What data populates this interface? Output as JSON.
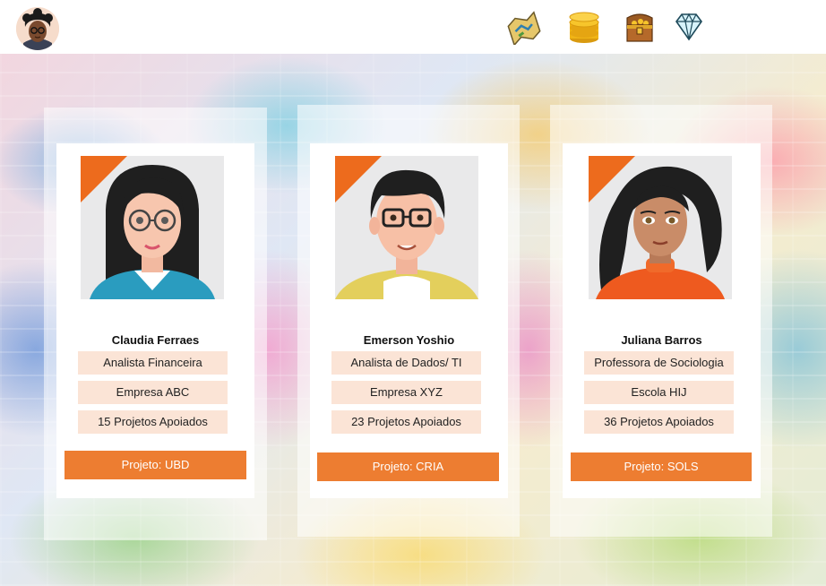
{
  "header": {
    "icons": [
      "map-icon",
      "coins-icon",
      "treasure-chest-icon",
      "diamond-icon"
    ]
  },
  "colors": {
    "accent": "#ed7d31",
    "info_box": "#fbe4d6"
  },
  "cards": [
    {
      "name": "Claudia Ferraes",
      "role": "Analista Financeira",
      "organization": "Empresa ABC",
      "projects": "15 Projetos Apoiados",
      "project_button": "Projeto: UBD"
    },
    {
      "name": "Emerson Yoshio",
      "role": "Analista de Dados/ TI",
      "organization": "Empresa XYZ",
      "projects": "23 Projetos Apoiados",
      "project_button": "Projeto: CRIA"
    },
    {
      "name": "Juliana Barros",
      "role": "Professora de Sociologia",
      "organization": "Escola HIJ",
      "projects": "36 Projetos Apoiados",
      "project_button": "Projeto: SOLS"
    }
  ]
}
